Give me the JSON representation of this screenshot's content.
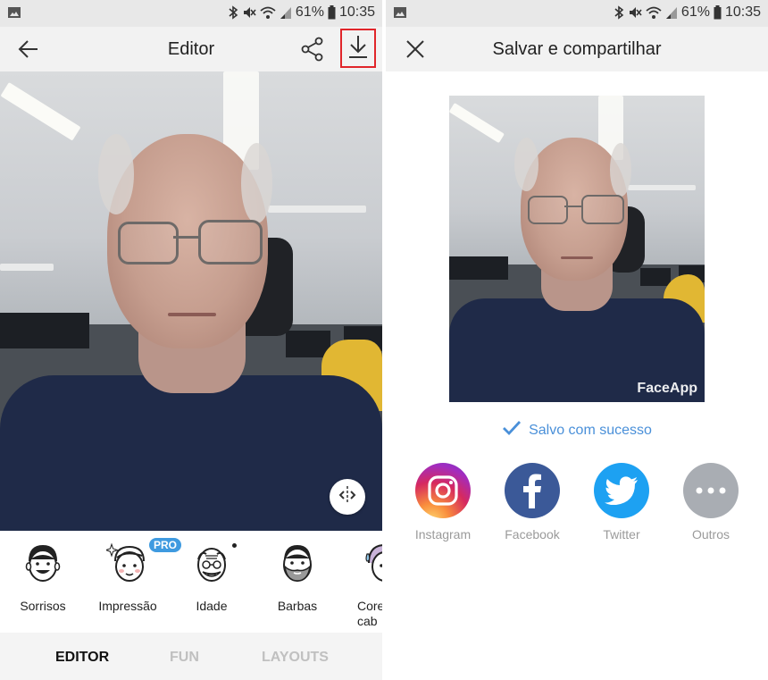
{
  "status": {
    "battery": "61%",
    "time": "10:35"
  },
  "editor": {
    "title": "Editor",
    "photo": {
      "description": ""
    },
    "tools": [
      {
        "label": "Sorrisos",
        "icon": "smile-face-icon"
      },
      {
        "label": "Impressão",
        "icon": "sparkle-face-icon",
        "badge": "PRO"
      },
      {
        "label": "Idade",
        "icon": "old-face-icon"
      },
      {
        "label": "Barbas",
        "icon": "beard-face-icon"
      },
      {
        "label": "Cores de cab",
        "line1": "Cores",
        "line2": "cab",
        "icon": "hair-color-face-icon"
      }
    ],
    "tabs": [
      {
        "label": "EDITOR",
        "active": true
      },
      {
        "label": "FUN",
        "active": false
      },
      {
        "label": "LAYOUTS",
        "active": false
      }
    ],
    "highlight_color": "#e0252a"
  },
  "share": {
    "title": "Salvar e compartilhar",
    "watermark": "FaceApp",
    "saved_message": "Salvo com sucesso",
    "targets": [
      {
        "label": "Instagram",
        "icon": "instagram-icon"
      },
      {
        "label": "Facebook",
        "icon": "facebook-icon",
        "color": "#3b5998"
      },
      {
        "label": "Twitter",
        "icon": "twitter-icon",
        "color": "#1da1f2"
      },
      {
        "label": "Outros",
        "icon": "more-icon",
        "color": "#a9adb3"
      }
    ],
    "accent": "#4a90d9"
  }
}
